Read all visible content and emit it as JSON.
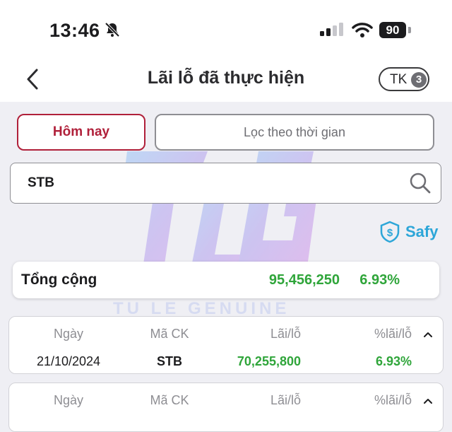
{
  "status_bar": {
    "time": "13:46",
    "battery": "90"
  },
  "header": {
    "title": "Lãi lỗ đã thực hiện",
    "account_label": "TK",
    "account_count": "3"
  },
  "filters": {
    "today_label": "Hôm nay",
    "range_label": "Lọc theo thời gian"
  },
  "search": {
    "value": "STB"
  },
  "brand": {
    "label": "Safy"
  },
  "watermark": {
    "text": "TU LE GENUINE"
  },
  "summary": {
    "label": "Tổng cộng",
    "profit": "95,456,250",
    "percent": "6.93%"
  },
  "columns": {
    "date": "Ngày",
    "code": "Mã CK",
    "profit": "Lãi/lỗ",
    "percent": "%lãi/lỗ"
  },
  "records": [
    {
      "date": "21/10/2024",
      "code": "STB",
      "profit": "70,255,800",
      "percent": "6.93%"
    }
  ],
  "colors": {
    "accent": "#b0203a",
    "positive": "#2fa53a",
    "brand": "#2da6d8"
  }
}
